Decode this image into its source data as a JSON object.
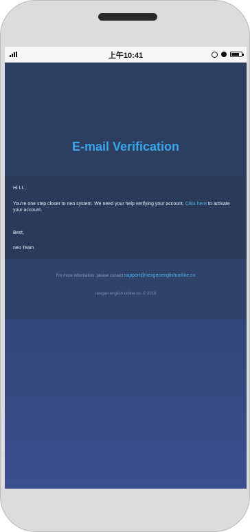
{
  "status_bar": {
    "time": "上午10:41",
    "signal_icon": "signal-bars-icon",
    "icons": [
      "rotation-lock-icon",
      "alarm-icon",
      "battery-icon"
    ]
  },
  "email": {
    "title": "E-mail Verification",
    "greeting": "Hi LL,",
    "body_text": "You're one step closer to neo system. We need your help verifying your account.",
    "link_text": "Click here",
    "body_text_after": "to activate your account.",
    "signoff": "Best,",
    "signature": "neo Team"
  },
  "footer": {
    "contact_text": "For more information, please contact",
    "support_email": "support@nexgenenglishonline.co",
    "copyright": "nexgen english online co. © 2018"
  },
  "colors": {
    "accent": "#3aa5e8",
    "link": "#4fb3ef",
    "email_background": "#2c3f60"
  }
}
